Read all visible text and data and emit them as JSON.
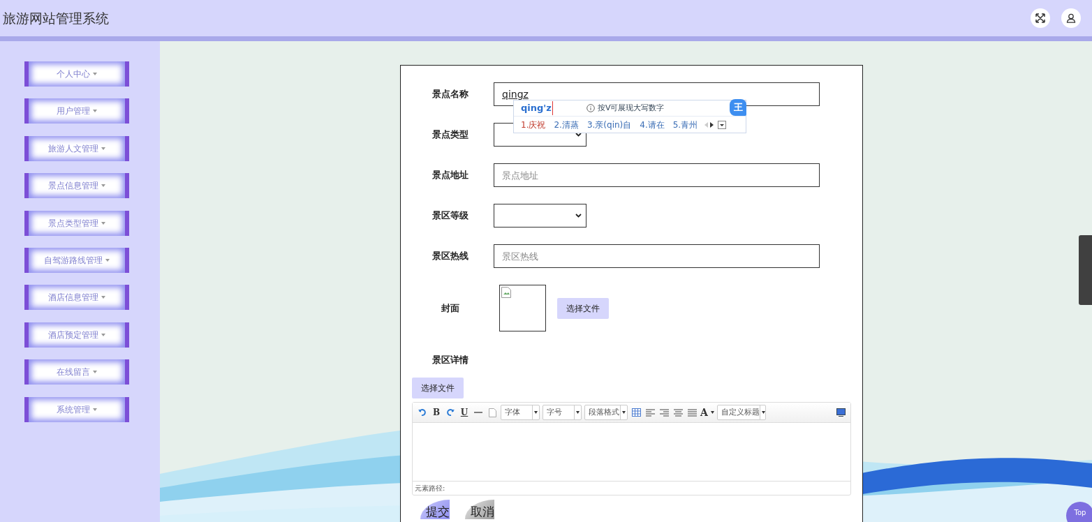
{
  "header": {
    "title": "旅游网站管理系统"
  },
  "sidebar": {
    "items": [
      {
        "label": "个人中心"
      },
      {
        "label": "用户管理"
      },
      {
        "label": "旅游人文管理"
      },
      {
        "label": "景点信息管理"
      },
      {
        "label": "景点类型管理"
      },
      {
        "label": "自驾游路线管理"
      },
      {
        "label": "酒店信息管理"
      },
      {
        "label": "酒店预定管理"
      },
      {
        "label": "在线留言"
      },
      {
        "label": "系统管理"
      }
    ]
  },
  "form": {
    "rows": [
      {
        "kind": "input",
        "label": "景点名称",
        "value": "qingz"
      },
      {
        "kind": "select",
        "label": "景点类型"
      },
      {
        "kind": "input",
        "label": "景点地址",
        "placeholder": "景点地址"
      },
      {
        "kind": "select",
        "label": "景区等级"
      },
      {
        "kind": "input",
        "label": "景区热线",
        "placeholder": "景区热线"
      },
      {
        "label": "封面",
        "button": "选择文件"
      },
      {
        "kind": "editor",
        "label": "景区详情",
        "button": "选择文件",
        "path_label": "元素路径:",
        "toolbar": [
          {
            "kind": "undo"
          },
          {
            "kind": "bold",
            "label": "B"
          },
          {
            "kind": "redo"
          },
          {
            "kind": "underline",
            "label": "U"
          },
          {
            "kind": "hr"
          },
          {
            "kind": "doc"
          },
          {
            "kind": "select",
            "label": "字体"
          },
          {
            "kind": "select",
            "label": "字号"
          },
          {
            "kind": "select",
            "label": "段落格式"
          },
          {
            "kind": "table"
          },
          {
            "kind": "align-left"
          },
          {
            "kind": "align-right"
          },
          {
            "kind": "align-center"
          },
          {
            "kind": "justify"
          },
          {
            "kind": "color",
            "label": "A"
          },
          {
            "kind": "select",
            "label": "自定义标题"
          },
          {
            "kind": "preview"
          }
        ]
      }
    ],
    "actions": [
      {
        "label": "提交",
        "kind": "primary"
      },
      {
        "label": "取消",
        "kind": "secondary"
      }
    ]
  },
  "ime": {
    "composition": "qing'z",
    "hint": "按V可展现大写数字",
    "logo": "王",
    "candidates": [
      {
        "label": "1.庆祝",
        "selected": true
      },
      {
        "label": "2.清蒸",
        "selected": false
      },
      {
        "label": "3.亲(qin)自",
        "selected": false
      },
      {
        "label": "4.请在",
        "selected": false
      },
      {
        "label": "5.青州",
        "selected": false
      }
    ]
  },
  "top_button": {
    "label": "Top"
  }
}
